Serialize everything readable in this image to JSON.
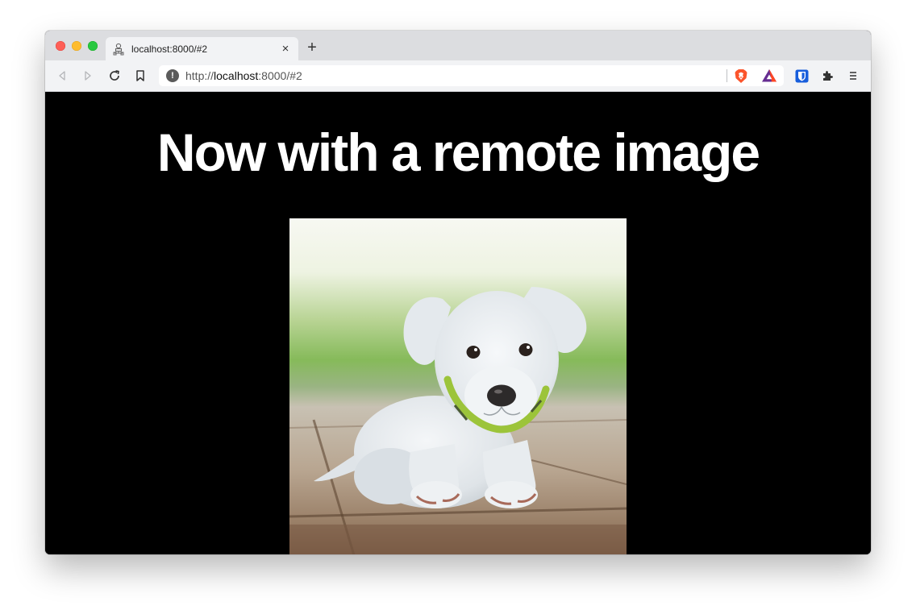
{
  "browser": {
    "tab": {
      "title": "localhost:8000/#2",
      "close_label": "×",
      "favicon": "server-network-icon"
    },
    "new_tab_label": "+",
    "address": {
      "scheme": "http://",
      "host": "localhost",
      "rest": ":8000/#2"
    },
    "toolbar_icons": [
      "back-icon",
      "forward-icon",
      "reload-icon",
      "bookmark-icon",
      "info-icon",
      "brave-shields-icon",
      "brave-rewards-icon",
      "bitwarden-icon",
      "extensions-icon",
      "menu-icon"
    ]
  },
  "page": {
    "heading": "Now with a remote image",
    "image": {
      "subject": "white puppy with green collar",
      "alt": "puppy"
    }
  },
  "colors": {
    "page_background": "#000000",
    "heading_color": "#ffffff",
    "brave_orange": "#fb542b",
    "bat_purple": "#662d91",
    "bitwarden_blue": "#175ddc"
  }
}
